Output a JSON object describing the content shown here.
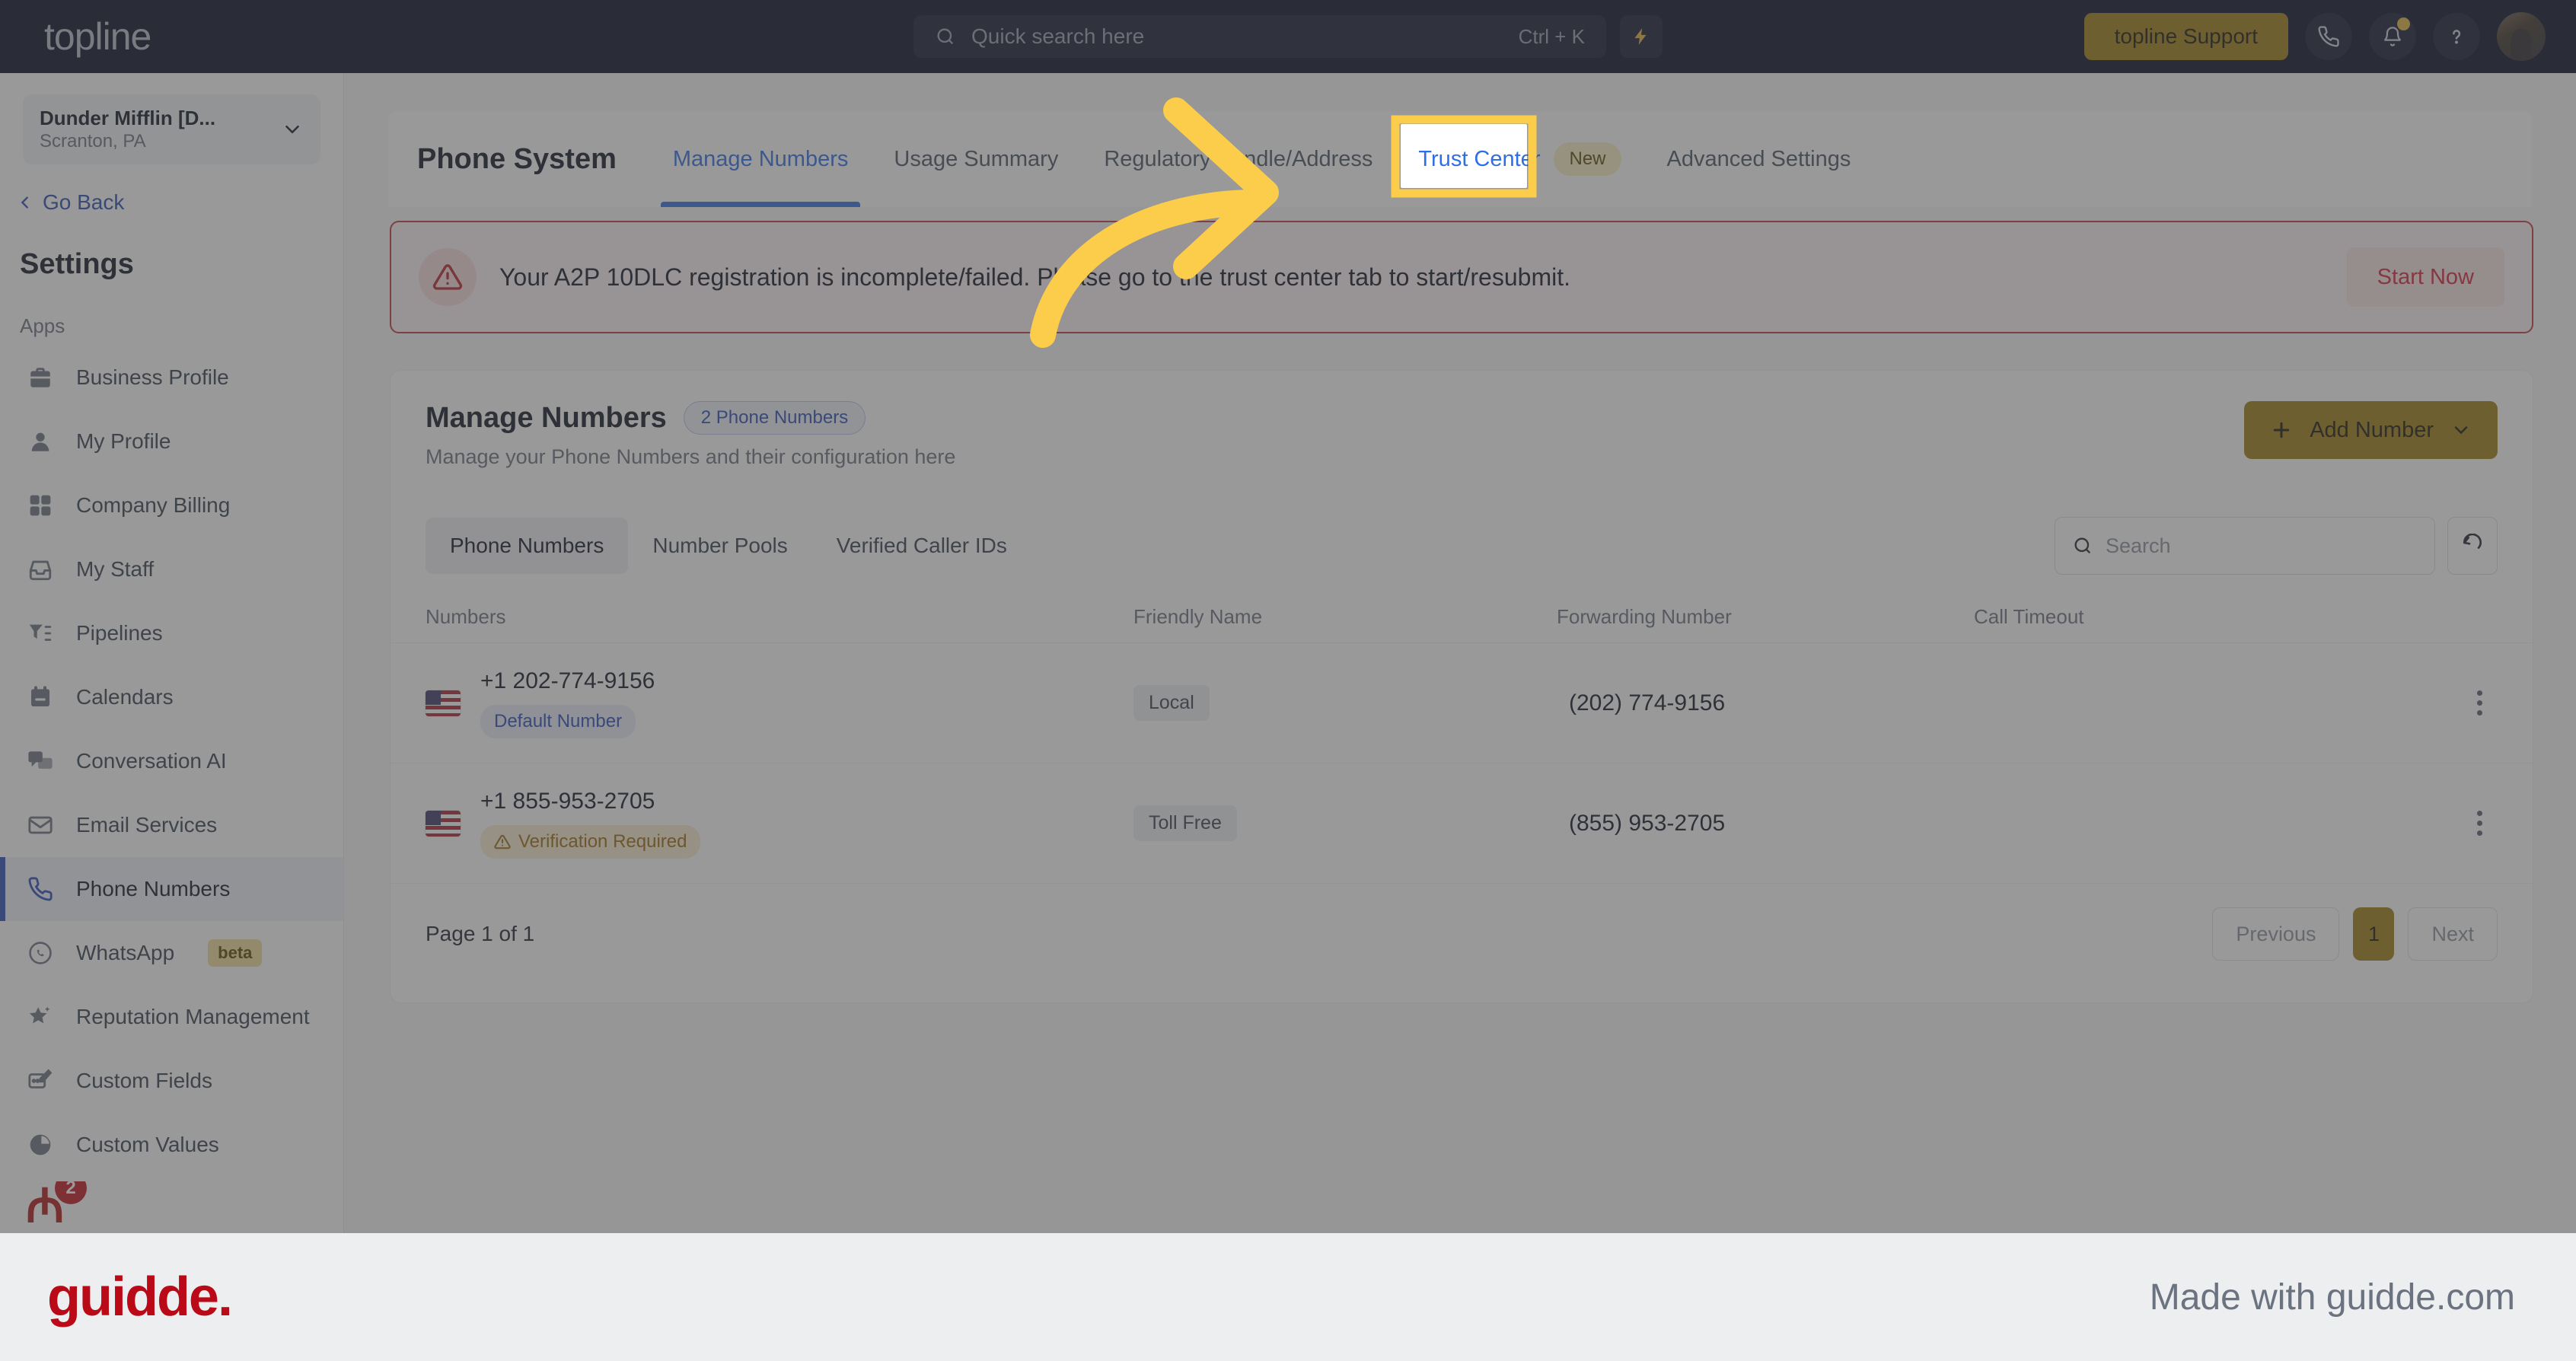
{
  "topbar": {
    "brand": "topline",
    "search": {
      "placeholder": "Quick search here",
      "shortcut": "Ctrl + K",
      "icon": "search-icon"
    },
    "bolt_icon": "lightning-bolt-icon",
    "support_button": "topline Support",
    "icons": [
      "phone-icon",
      "bell-icon",
      "help-icon"
    ],
    "avatar": "user-avatar"
  },
  "sidebar": {
    "org": {
      "name": "Dunder Mifflin [D...",
      "location": "Scranton, PA",
      "chevron": "chevron-down-icon"
    },
    "go_back": "Go Back",
    "title": "Settings",
    "section_label": "Apps",
    "items": [
      {
        "label": "Business Profile",
        "icon": "briefcase-icon",
        "active": false
      },
      {
        "label": "My Profile",
        "icon": "person-icon",
        "active": false
      },
      {
        "label": "Company Billing",
        "icon": "calculator-icon",
        "active": false
      },
      {
        "label": "My Staff",
        "icon": "inbox-icon",
        "active": false
      },
      {
        "label": "Pipelines",
        "icon": "funnel-icon",
        "active": false
      },
      {
        "label": "Calendars",
        "icon": "calendar-icon",
        "active": false
      },
      {
        "label": "Conversation AI",
        "icon": "chat-bubbles-icon",
        "active": false
      },
      {
        "label": "Email Services",
        "icon": "envelope-icon",
        "active": false
      },
      {
        "label": "Phone Numbers",
        "icon": "phone-icon",
        "active": true
      },
      {
        "label": "WhatsApp",
        "icon": "whatsapp-icon",
        "badge": "beta",
        "active": false
      },
      {
        "label": "Reputation Management",
        "icon": "star-sparkle-icon",
        "active": false
      },
      {
        "label": "Custom Fields",
        "icon": "pencil-card-icon",
        "active": false
      },
      {
        "label": "Custom Values",
        "icon": "pie-chart-icon",
        "active": false
      }
    ],
    "partial_item_badge": "2"
  },
  "tabs": {
    "heading": "Phone System",
    "items": [
      {
        "label": "Manage Numbers",
        "state": "selected"
      },
      {
        "label": "Usage Summary",
        "state": "normal"
      },
      {
        "label": "Regulatory Bundle/Address",
        "state": "normal"
      },
      {
        "label": "Trust Center",
        "state": "link",
        "badge": "New",
        "highlighted": true
      },
      {
        "label": "Advanced Settings",
        "state": "normal"
      }
    ]
  },
  "alert": {
    "icon": "warning-triangle-icon",
    "message": "Your A2P 10DLC registration is incomplete/failed. Please go to the trust center tab to start/resubmit.",
    "action": "Start Now"
  },
  "panel": {
    "title": "Manage Numbers",
    "count_pill": "2 Phone Numbers",
    "subtitle": "Manage your Phone Numbers and their configuration here",
    "add_button": "Add Number",
    "add_button_icon": "plus-icon",
    "add_button_chevron": "chevron-down-icon",
    "subtabs": [
      {
        "label": "Phone Numbers",
        "active": true
      },
      {
        "label": "Number Pools",
        "active": false
      },
      {
        "label": "Verified Caller IDs",
        "active": false
      }
    ],
    "search_placeholder": "Search",
    "search_icon": "search-icon",
    "refresh_icon": "refresh-icon"
  },
  "table": {
    "columns": [
      "Numbers",
      "Friendly Name",
      "Forwarding Number",
      "Call Timeout"
    ],
    "rows": [
      {
        "flag": "us-flag-icon",
        "number": "+1 202-774-9156",
        "status_pill": "Default Number",
        "status_kind": "default",
        "type_chip": "Local",
        "friendly_name": "(202) 774-9156",
        "forwarding_number": "",
        "call_timeout": "",
        "menu_icon": "kebab-menu-icon"
      },
      {
        "flag": "us-flag-icon",
        "number": "+1 855-953-2705",
        "status_pill": "Verification Required",
        "status_kind": "verify",
        "type_chip": "Toll Free",
        "friendly_name": "(855) 953-2705",
        "forwarding_number": "",
        "call_timeout": "",
        "menu_icon": "kebab-menu-icon"
      }
    ],
    "footer": {
      "page_info": "Page 1 of 1",
      "previous": "Previous",
      "current_page": "1",
      "next": "Next"
    }
  },
  "annotation": {
    "arrow_color": "#FBCD4B",
    "highlight_color": "#FBCD4B"
  },
  "guidde": {
    "logo": "guidde.",
    "made_with": "Made with guidde.com"
  },
  "colors": {
    "topbar_bg": "#070d26",
    "accent_gold": "#a07d17",
    "link_blue": "#2f6fe4",
    "alert_red": "#c0393f",
    "guidde_red": "#bb0a17"
  }
}
